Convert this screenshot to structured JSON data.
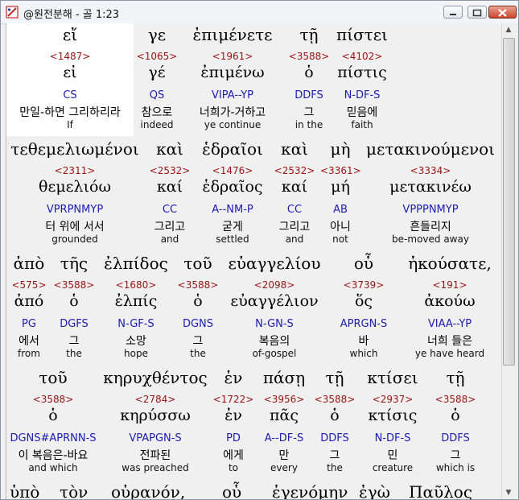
{
  "window": {
    "title": "@원전분해 - 골 1:23"
  },
  "rows": [
    [
      {
        "greek": "εἴ",
        "num": "<1487>",
        "lemma": "εἰ",
        "parse": "CS",
        "kor": "만일-하면 그리하리라",
        "eng": "If"
      },
      {
        "greek": "γε",
        "num": "<1065>",
        "lemma": "γέ",
        "parse": "QS",
        "kor": "참으로",
        "eng": "indeed"
      },
      {
        "greek": "ἐπιμένετε",
        "num": "<1961>",
        "lemma": "ἐπιμένω",
        "parse": "VIPA--YP",
        "kor": "너희가-거하고",
        "eng": "ye continue"
      },
      {
        "greek": "τῇ",
        "num": "<3588>",
        "lemma": "ὁ",
        "parse": "DDFS",
        "kor": "그",
        "eng": "in the"
      },
      {
        "greek": "πίστει",
        "num": "<4102>",
        "lemma": "πίστις",
        "parse": "N-DF-S",
        "kor": "믿음에",
        "eng": "faith"
      }
    ],
    [
      {
        "greek": "τεθεμελιωμένοι",
        "num": "<2311>",
        "lemma": "θεμελιόω",
        "parse": "VPRPNMYP",
        "kor": "터 위에 서서",
        "eng": "grounded"
      },
      {
        "greek": "καὶ",
        "num": "<2532>",
        "lemma": "καί",
        "parse": "CC",
        "kor": "그리고",
        "eng": "and"
      },
      {
        "greek": "ἑδραῖοι",
        "num": "<1476>",
        "lemma": "ἑδραῖος",
        "parse": "A--NM-P",
        "kor": "굳게",
        "eng": "settled"
      },
      {
        "greek": "καὶ",
        "num": "<2532>",
        "lemma": "καί",
        "parse": "CC",
        "kor": "그리고",
        "eng": "and"
      },
      {
        "greek": "μὴ",
        "num": "<3361>",
        "lemma": "μή",
        "parse": "AB",
        "kor": "아니",
        "eng": "not"
      },
      {
        "greek": "μετακινούμενοι",
        "num": "<3334>",
        "lemma": "μετακινέω",
        "parse": "VPPPNMYP",
        "kor": "흔들리지",
        "eng": "be-moved away"
      }
    ],
    [
      {
        "greek": "ἀπὸ",
        "num": "<575>",
        "lemma": "ἀπό",
        "parse": "PG",
        "kor": "에서",
        "eng": "from"
      },
      {
        "greek": "τῆς",
        "num": "<3588>",
        "lemma": "ὁ",
        "parse": "DGFS",
        "kor": "그",
        "eng": "the"
      },
      {
        "greek": "ἐλπίδος",
        "num": "<1680>",
        "lemma": "ἐλπίς",
        "parse": "N-GF-S",
        "kor": "소망",
        "eng": "hope"
      },
      {
        "greek": "τοῦ",
        "num": "<3588>",
        "lemma": "ὁ",
        "parse": "DGNS",
        "kor": "그",
        "eng": "the"
      },
      {
        "greek": "εὐαγγελίου",
        "num": "<2098>",
        "lemma": "εὐαγγέλιον",
        "parse": "N-GN-S",
        "kor": "복음의",
        "eng": "of-gospel"
      },
      {
        "greek": "οὗ",
        "num": "<3739>",
        "lemma": "ὅς",
        "parse": "APRGN-S",
        "kor": "바",
        "eng": "which"
      },
      {
        "greek": "ἠκούσατε,",
        "num": "<191>",
        "lemma": "ἀκούω",
        "parse": "VIAA--YP",
        "kor": "너희 들은",
        "eng": "ye have heard"
      }
    ],
    [
      {
        "greek": "τοῦ",
        "num": "<3588>",
        "lemma": "ὁ",
        "parse": "DGNS#APRNN-S",
        "kor": "이 복음은-바요",
        "eng": "and which"
      },
      {
        "greek": "κηρυχθέντος",
        "num": "<2784>",
        "lemma": "κηρύσσω",
        "parse": "VPAPGN-S",
        "kor": "전파된",
        "eng": "was preached"
      },
      {
        "greek": "ἐν",
        "num": "<1722>",
        "lemma": "ἐν",
        "parse": "PD",
        "kor": "에게",
        "eng": "to"
      },
      {
        "greek": "πάσῃ",
        "num": "<3956>",
        "lemma": "πᾶς",
        "parse": "A--DF-S",
        "kor": "만",
        "eng": "every"
      },
      {
        "greek": "τῇ",
        "num": "<3588>",
        "lemma": "ὁ",
        "parse": "DDFS",
        "kor": "그",
        "eng": "the"
      },
      {
        "greek": "κτίσει",
        "num": "<2937>",
        "lemma": "κτίσις",
        "parse": "N-DF-S",
        "kor": "민",
        "eng": "creature"
      },
      {
        "greek": "τῇ",
        "num": "<3588>",
        "lemma": "ὁ",
        "parse": "DDFS",
        "kor": "그",
        "eng": "which is"
      }
    ]
  ],
  "partial_row": [
    "ὑπὸ",
    "τὸν",
    "οὐρανόν,",
    "οὗ",
    "ἐγενόμην",
    "ἐγὼ",
    "Παῦλος"
  ]
}
